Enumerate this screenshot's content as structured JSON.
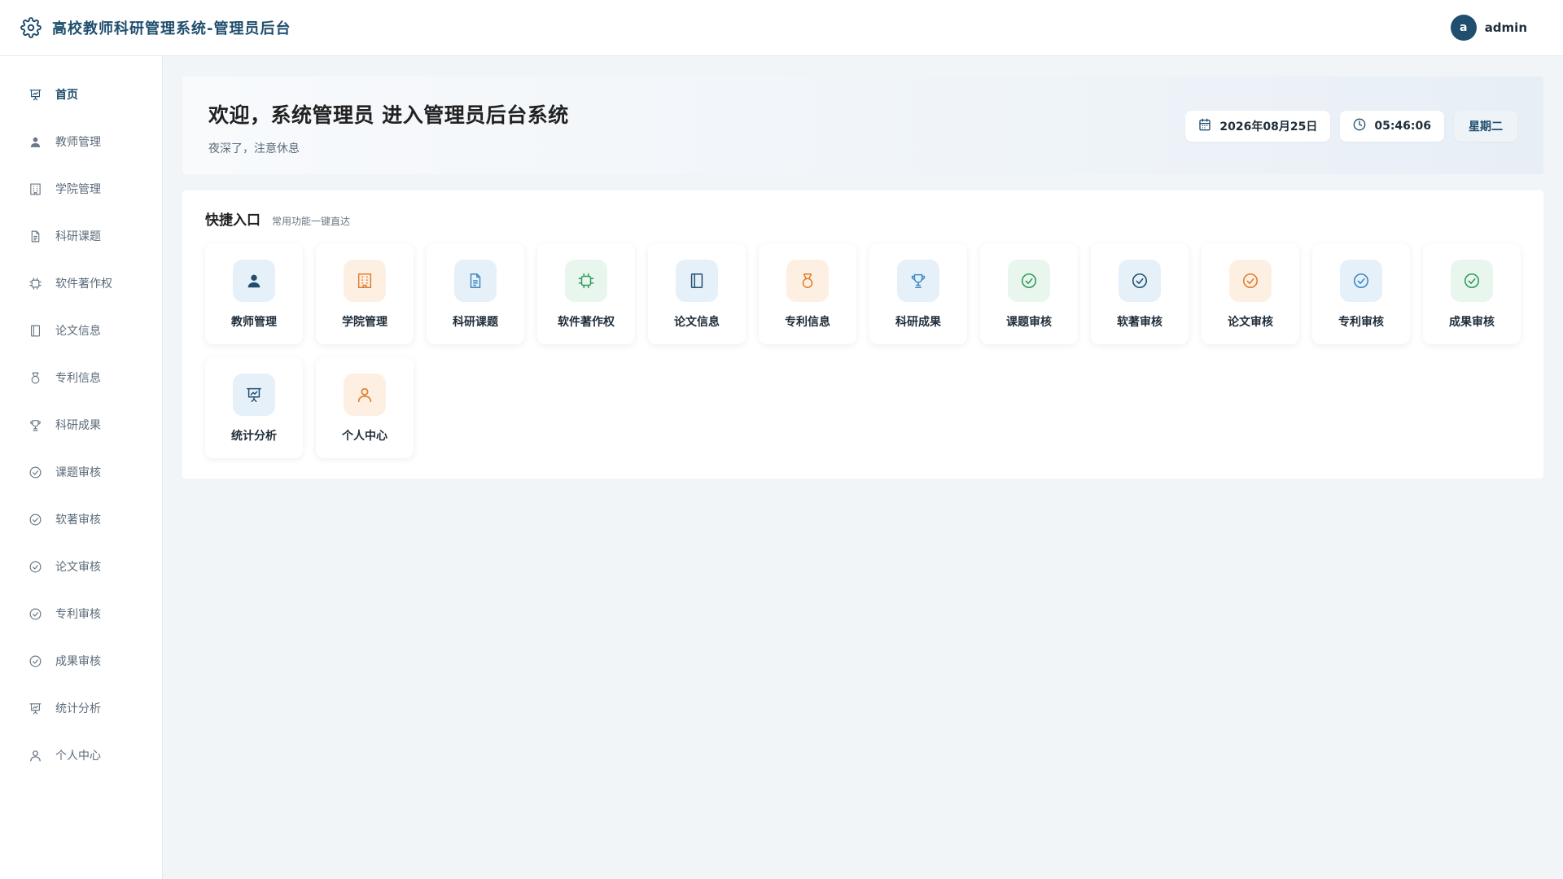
{
  "header": {
    "title": "高校教师科研管理系统-管理员后台",
    "avatar_letter": "a",
    "username": "admin"
  },
  "sidebar": {
    "items": [
      {
        "label": "首页",
        "icon": "presentation-chart-icon",
        "active": true
      },
      {
        "label": "教师管理",
        "icon": "user-icon"
      },
      {
        "label": "学院管理",
        "icon": "building-icon"
      },
      {
        "label": "科研课题",
        "icon": "document-icon"
      },
      {
        "label": "软件著作权",
        "icon": "chip-icon"
      },
      {
        "label": "论文信息",
        "icon": "notebook-icon"
      },
      {
        "label": "专利信息",
        "icon": "medal-icon"
      },
      {
        "label": "科研成果",
        "icon": "trophy-icon"
      },
      {
        "label": "课题审核",
        "icon": "check-circle-icon"
      },
      {
        "label": "软著审核",
        "icon": "check-circle-icon"
      },
      {
        "label": "论文审核",
        "icon": "check-circle-icon"
      },
      {
        "label": "专利审核",
        "icon": "check-circle-icon"
      },
      {
        "label": "成果审核",
        "icon": "check-circle-icon"
      },
      {
        "label": "统计分析",
        "icon": "presentation-chart-icon"
      },
      {
        "label": "个人中心",
        "icon": "user-outline-icon"
      }
    ]
  },
  "welcome": {
    "heading": "欢迎，系统管理员 进入管理员后台系统",
    "subtitle": "夜深了，注意休息",
    "date": "2026年08月25日",
    "time": "05:46:06",
    "weekday": "星期二"
  },
  "quick": {
    "title": "快捷入口",
    "subtitle": "常用功能一键直达",
    "tiles": [
      {
        "label": "教师管理",
        "icon": "user-icon",
        "tone": "blue",
        "color": "#1f4e6e"
      },
      {
        "label": "学院管理",
        "icon": "building-icon",
        "tone": "orange",
        "color": "#e07b2a"
      },
      {
        "label": "科研课题",
        "icon": "document-icon",
        "tone": "blue",
        "color": "#3a87c2"
      },
      {
        "label": "软件著作权",
        "icon": "chip-icon",
        "tone": "green",
        "color": "#2f9a5c"
      },
      {
        "label": "论文信息",
        "icon": "notebook-icon",
        "tone": "blue",
        "color": "#1f4e6e"
      },
      {
        "label": "专利信息",
        "icon": "medal-icon",
        "tone": "orange",
        "color": "#e07b2a"
      },
      {
        "label": "科研成果",
        "icon": "trophy-icon",
        "tone": "blue",
        "color": "#3a87c2"
      },
      {
        "label": "课题审核",
        "icon": "check-circle-icon",
        "tone": "green",
        "color": "#2f9a5c"
      },
      {
        "label": "软著审核",
        "icon": "check-circle-icon",
        "tone": "blue",
        "color": "#1f4e6e"
      },
      {
        "label": "论文审核",
        "icon": "check-circle-icon",
        "tone": "orange",
        "color": "#e07b2a"
      },
      {
        "label": "专利审核",
        "icon": "check-circle-icon",
        "tone": "blue",
        "color": "#3a87c2"
      },
      {
        "label": "成果审核",
        "icon": "check-circle-icon",
        "tone": "green",
        "color": "#2f9a5c"
      },
      {
        "label": "统计分析",
        "icon": "presentation-chart-icon",
        "tone": "blue",
        "color": "#1f4e6e"
      },
      {
        "label": "个人中心",
        "icon": "user-outline-icon",
        "tone": "orange",
        "color": "#e07b2a"
      }
    ]
  },
  "colors": {
    "primary": "#1f4e6e",
    "sidebar_text": "#5c6b7a",
    "background": "#f2f5f8"
  }
}
